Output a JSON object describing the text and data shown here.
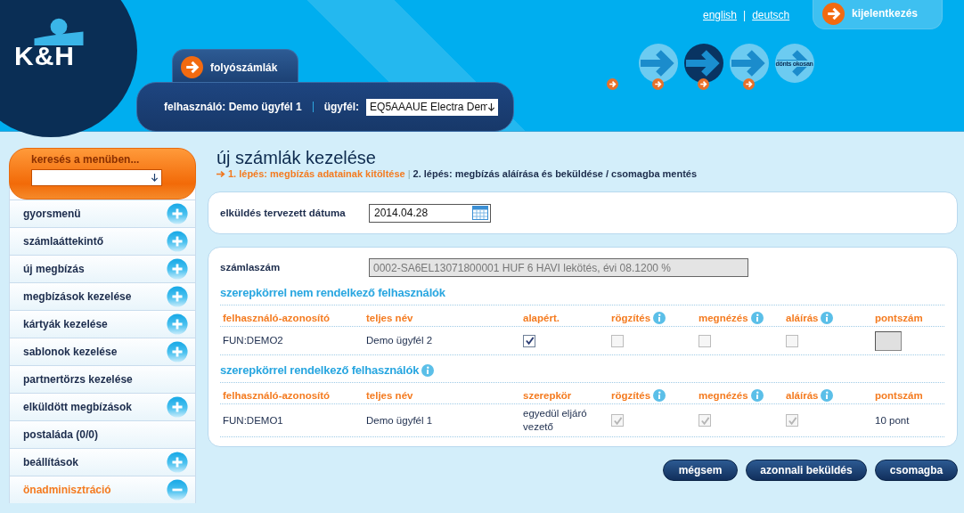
{
  "header": {
    "logo": "K&H",
    "languages": [
      {
        "label": "english"
      },
      {
        "label": "deutsch"
      }
    ],
    "language_separator": "|",
    "logout": "kijelentkezés",
    "tab": "folyószámlák",
    "user_label": "felhasználó: Demo ügyfél 1",
    "client_label": "ügyfél:",
    "client_value": "EQ5AAAUE Electra Dem",
    "steps": [
      {
        "selected": false
      },
      {
        "selected": true
      },
      {
        "selected": false
      },
      {
        "label": "dönts okosan",
        "selected": false
      }
    ]
  },
  "sidebar": {
    "search_label": "keresés a menüben...",
    "items": [
      {
        "label": "gyorsmenü",
        "expandable": true,
        "expanded": false
      },
      {
        "label": "számlaáttekintő",
        "expandable": true,
        "expanded": false
      },
      {
        "label": "új megbízás",
        "expandable": true,
        "expanded": false
      },
      {
        "label": "megbízások kezelése",
        "expandable": true,
        "expanded": false
      },
      {
        "label": "kártyák kezelése",
        "expandable": true,
        "expanded": false
      },
      {
        "label": "sablonok kezelése",
        "expandable": true,
        "expanded": false
      },
      {
        "label": "partnertörzs kezelése",
        "expandable": false,
        "expanded": false
      },
      {
        "label": "elküldött megbízások",
        "expandable": true,
        "expanded": false
      },
      {
        "label": "postaláda (0/0)",
        "expandable": false,
        "expanded": false
      },
      {
        "label": "beállítások",
        "expandable": true,
        "expanded": false
      },
      {
        "label": "önadminisztráció",
        "expandable": true,
        "expanded": true
      }
    ]
  },
  "page": {
    "title": "új számlák kezelése",
    "steps": [
      {
        "label": "1. lépés: megbízás adatainak kitöltése",
        "selected": true
      },
      {
        "label": "2. lépés: megbízás aláírása és beküldése / csomagba mentés",
        "selected": false
      }
    ],
    "step_separator": "|"
  },
  "date_card": {
    "label": "elküldés tervezett dátuma",
    "value": "2014.04.28"
  },
  "account": {
    "label": "számlaszám",
    "value": "0002-SA6EL13071800001 HUF 6 HAVI lekötés, évi 08.1200 %"
  },
  "sections": [
    {
      "title": "szerepkörrel nem rendelkező felhasználók",
      "info": false,
      "columns": [
        {
          "label": "felhasználó-azonosító",
          "info": false
        },
        {
          "label": "teljes név",
          "info": false
        },
        {
          "label": "alapért.",
          "info": false
        },
        {
          "label": "rögzítés",
          "info": true
        },
        {
          "label": "megnézés",
          "info": true
        },
        {
          "label": "aláírás",
          "info": true
        },
        {
          "label": "pontszám",
          "info": false
        }
      ],
      "rows": [
        {
          "cells": [
            {
              "kind": "text",
              "text": "FUN:DEMO2"
            },
            {
              "kind": "text",
              "text": "Demo ügyfél 2"
            },
            {
              "kind": "checkbox",
              "checked": true,
              "disabled": false
            },
            {
              "kind": "checkbox",
              "checked": false,
              "disabled": true
            },
            {
              "kind": "checkbox",
              "checked": false,
              "disabled": true
            },
            {
              "kind": "checkbox",
              "checked": false,
              "disabled": true
            },
            {
              "kind": "input"
            }
          ]
        }
      ]
    },
    {
      "title": "szerepkörrel rendelkező felhasználók",
      "info": true,
      "columns": [
        {
          "label": "felhasználó-azonosító",
          "info": false
        },
        {
          "label": "teljes név",
          "info": false
        },
        {
          "label": "szerepkör",
          "info": false
        },
        {
          "label": "rögzítés",
          "info": true
        },
        {
          "label": "megnézés",
          "info": true
        },
        {
          "label": "aláírás",
          "info": true
        },
        {
          "label": "pontszám",
          "info": false
        }
      ],
      "rows": [
        {
          "cells": [
            {
              "kind": "text",
              "text": "FUN:DEMO1"
            },
            {
              "kind": "text",
              "text": "Demo ügyfél 1"
            },
            {
              "kind": "text",
              "text": "egyedül eljáró vezető"
            },
            {
              "kind": "checkbox",
              "checked": true,
              "disabled": true
            },
            {
              "kind": "checkbox",
              "checked": true,
              "disabled": true
            },
            {
              "kind": "checkbox",
              "checked": true,
              "disabled": true
            },
            {
              "kind": "text",
              "text": "10 pont"
            }
          ]
        }
      ]
    }
  ],
  "buttons": [
    "mégsem",
    "azonnali beküldés",
    "csomagba"
  ]
}
